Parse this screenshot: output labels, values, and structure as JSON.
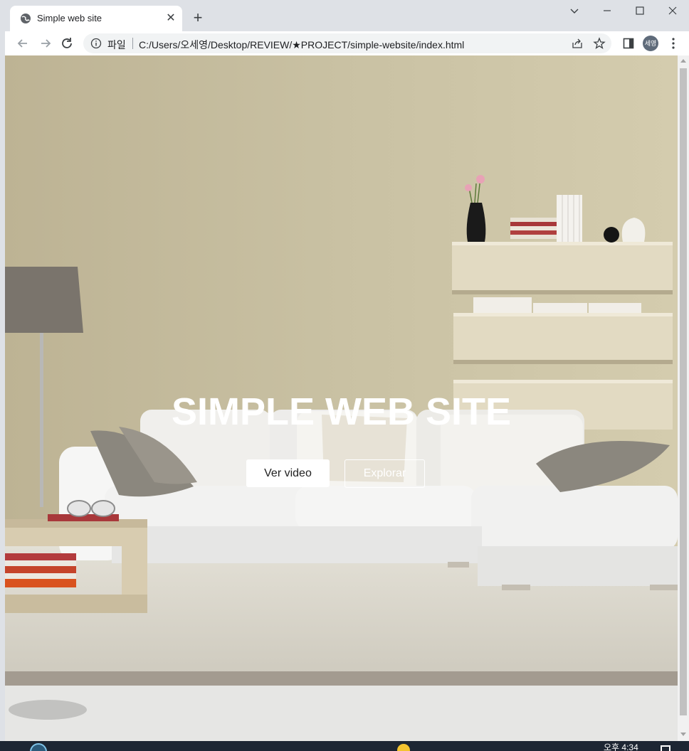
{
  "browser": {
    "tab": {
      "title": "Simple web site",
      "close_glyph": "✕"
    },
    "new_tab_glyph": "+",
    "omnibox": {
      "scheme_label": "파일",
      "url": "C:/Users/오세영/Desktop/REVIEW/★PROJECT/simple-website/index.html"
    },
    "profile_initials": "세영",
    "icons": [
      "globe-icon",
      "back-arrow-icon",
      "forward-arrow-icon",
      "reload-icon",
      "info-icon",
      "share-icon",
      "star-icon",
      "side-panel-icon",
      "kebab-menu-icon",
      "minimize-icon",
      "maximize-icon",
      "close-icon",
      "chevron-down-icon"
    ]
  },
  "hero": {
    "title": "SIMPLE WEB SITE",
    "primary_button": "Ver video",
    "secondary_button": "Explorar"
  },
  "taskbar": {
    "clock": "오후 4:34"
  }
}
